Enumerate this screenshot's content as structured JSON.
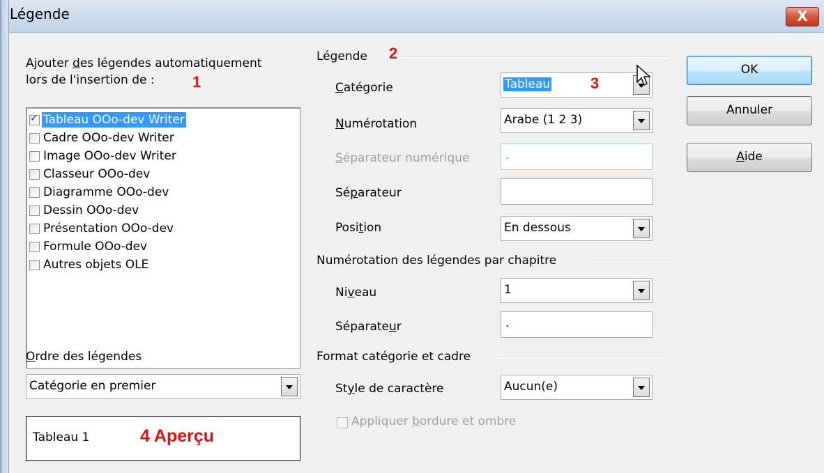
{
  "window": {
    "title": "Légende",
    "close_label": "X"
  },
  "left": {
    "intro_pre": "Ajouter ",
    "intro_ul": "d",
    "intro_post": "es légendes automatiquement",
    "intro_line2": "lors de l'insertion de :",
    "marker": "1",
    "items": [
      {
        "label": "Tableau OOo-dev Writer",
        "checked": true,
        "selected": true
      },
      {
        "label": "Cadre OOo-dev Writer",
        "checked": false
      },
      {
        "label": "Image OOo-dev Writer",
        "checked": false
      },
      {
        "label": "Classeur OOo-dev",
        "checked": false
      },
      {
        "label": "Diagramme OOo-dev",
        "checked": false
      },
      {
        "label": "Dessin OOo-dev",
        "checked": false
      },
      {
        "label": "Présentation OOo-dev",
        "checked": false
      },
      {
        "label": "Formule OOo-dev",
        "checked": false
      },
      {
        "label": "Autres objets OLE",
        "checked": false
      }
    ],
    "order_label_ul": "O",
    "order_label_rest": "rdre des légendes",
    "order_value": "Catégorie en premier",
    "preview_text": "Tableau 1",
    "preview_marker": "4 Aperçu"
  },
  "legend": {
    "section_title": "Légende",
    "marker": "2",
    "category_label_ul": "C",
    "category_label_rest": "atégorie",
    "category_value": "Tableau",
    "category_marker": "3",
    "numbering_label_ul": "N",
    "numbering_label_rest": "umérotation",
    "numbering_value": "Arabe (1 2 3)",
    "num_sep_label_ul": "S",
    "num_sep_label_rest": "éparateur numérique",
    "num_sep_value": ".",
    "separator_label_pre": "Sé",
    "separator_label_ul": "p",
    "separator_label_rest": "arateur",
    "separator_value": "",
    "position_label_pre": "Posi",
    "position_label_ul": "t",
    "position_label_rest": "ion",
    "position_value": "En dessous"
  },
  "chapter": {
    "section_title": "Numérotation des légendes par chapitre",
    "level_label_pre": "Ni",
    "level_label_ul": "v",
    "level_label_rest": "eau",
    "level_value": "1",
    "separator_label_pre": "Séparate",
    "separator_label_ul": "u",
    "separator_label_rest": "r",
    "separator_value": "."
  },
  "format": {
    "section_title": "Format catégorie et cadre",
    "char_style_label_pre": "St",
    "char_style_label_ul": "y",
    "char_style_label_rest": "le de caractère",
    "char_style_value": "Aucun(e)",
    "border_label_pre": "Appliquer ",
    "border_label_ul": "b",
    "border_label_rest": "ordure et ombre"
  },
  "buttons": {
    "ok": "OK",
    "cancel": "Annuler",
    "help_ul": "A",
    "help_rest": "ide"
  }
}
